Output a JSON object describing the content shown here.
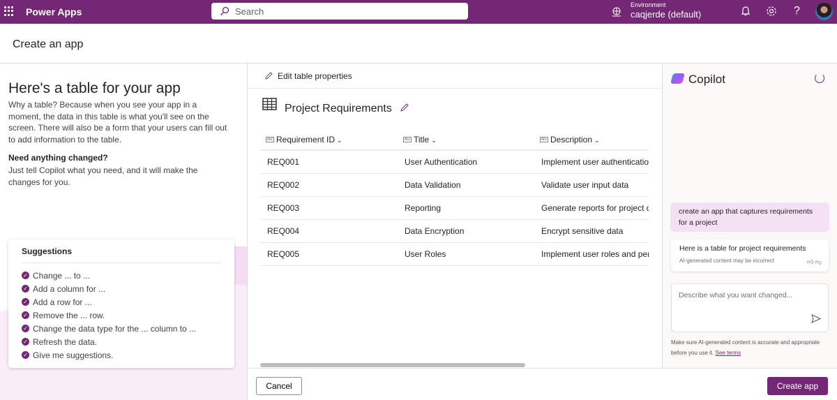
{
  "header": {
    "app_name": "Power Apps",
    "search_placeholder": "Search",
    "environment_label": "Environment",
    "environment_value": "caqjerde (default)"
  },
  "page_title": "Create an app",
  "left": {
    "heading": "Here's a table for your app",
    "intro": "Why a table? Because when you see your app in a moment, the data in this table is what you'll see on the screen. There will also be a form that your users can fill out to add information to the table.",
    "need_heading": "Need anything changed?",
    "need_text": "Just tell Copilot what you need, and it will make the changes for you.",
    "suggestions_title": "Suggestions",
    "suggestions": [
      "Change ... to ...",
      "Add a column for ...",
      "Add a row for ...",
      "Remove the ... row.",
      "Change the data type for the ... column to ...",
      "Refresh the data.",
      "Give me suggestions."
    ]
  },
  "table": {
    "edit_properties": "Edit table properties",
    "name": "Project Requirements",
    "columns": [
      "Requirement ID",
      "Title",
      "Description"
    ],
    "rows": [
      [
        "REQ001",
        "User Authentication",
        "Implement user authentication f"
      ],
      [
        "REQ002",
        "Data Validation",
        "Validate user input data"
      ],
      [
        "REQ003",
        "Reporting",
        "Generate reports for project dat"
      ],
      [
        "REQ004",
        "Data Encryption",
        "Encrypt sensitive data"
      ],
      [
        "REQ005",
        "User Roles",
        "Implement user roles and permi"
      ]
    ]
  },
  "copilot": {
    "title": "Copilot",
    "user_message": "create an app that captures requirements for a project",
    "assistant_message": "Here is a table for project requirements",
    "ai_note": "AI-generated content may be incorrect",
    "input_placeholder": "Describe what you want changed...",
    "disclaimer": "Make sure AI-generated content is accurate and appropriate before you use it.",
    "terms_link": "See terms"
  },
  "footer": {
    "cancel": "Cancel",
    "create": "Create app"
  }
}
